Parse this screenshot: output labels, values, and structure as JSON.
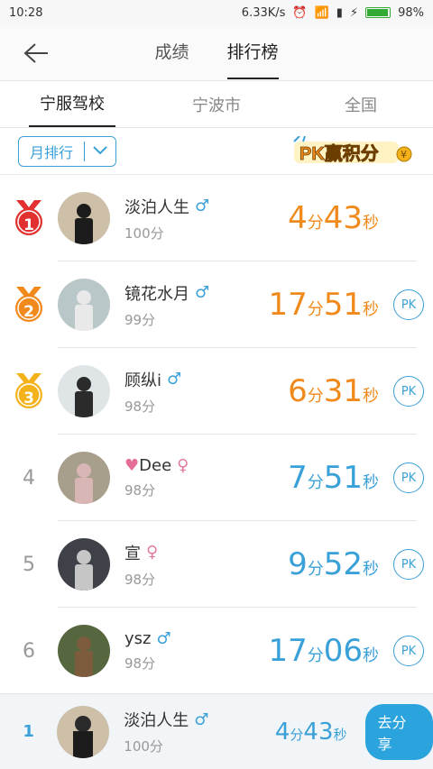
{
  "status_bar": {
    "time": "10:28",
    "speed": "6.33K/s",
    "battery": "98%"
  },
  "header": {
    "tabs": [
      "成绩",
      "排行榜"
    ],
    "active_tab": 1
  },
  "subtabs": [
    "宁服驾校",
    "宁波市",
    "全国"
  ],
  "filter": {
    "month_label": "月排行",
    "pk_badge": "PK赢积分"
  },
  "colors": {
    "accent": "#3aa0d8",
    "orange": "#f08a1c",
    "red": "#e23030",
    "gold": "#f3b21b"
  },
  "rows": [
    {
      "rank": "1",
      "name": "淡泊人生",
      "gender": "male",
      "score": "100分",
      "min": "4",
      "sec": "43",
      "pk": false,
      "medal": "red"
    },
    {
      "rank": "2",
      "name": "镜花水月",
      "gender": "male",
      "score": "99分",
      "min": "17",
      "sec": "51",
      "pk": true,
      "medal": "orange"
    },
    {
      "rank": "3",
      "name": "顾纵i",
      "gender": "male",
      "score": "98分",
      "min": "6",
      "sec": "31",
      "pk": true,
      "medal": "gold"
    },
    {
      "rank": "4",
      "name": "Dee",
      "gender": "female",
      "score": "98分",
      "min": "7",
      "sec": "51",
      "pk": true,
      "heart": true
    },
    {
      "rank": "5",
      "name": "宣",
      "gender": "female",
      "score": "98分",
      "min": "9",
      "sec": "52",
      "pk": true
    },
    {
      "rank": "6",
      "name": "ysz",
      "gender": "male",
      "score": "98分",
      "min": "17",
      "sec": "06",
      "pk": true
    }
  ],
  "pk_label": "PK",
  "units": {
    "min": "分",
    "sec": "秒"
  },
  "footer": {
    "rank": "1",
    "name": "淡泊人生",
    "gender": "male",
    "score": "100分",
    "min": "4",
    "sec": "43",
    "share_label": "去分享"
  }
}
